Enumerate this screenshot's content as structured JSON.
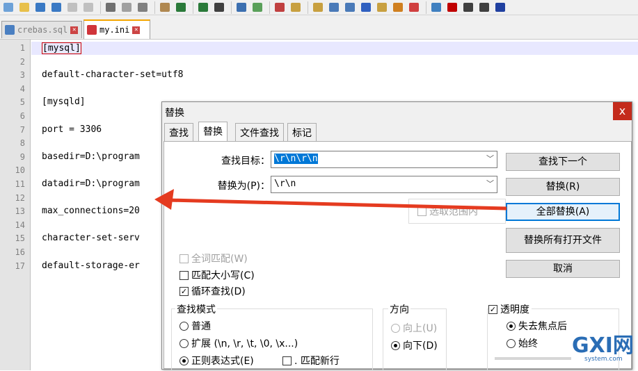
{
  "toolbar": {
    "icons": [
      "new-file-icon",
      "open-file-icon",
      "save-icon",
      "save-all-icon",
      "close-icon",
      "close-all-icon",
      "print-icon",
      "cut-icon",
      "copy-icon",
      "paste-icon",
      "undo-icon",
      "redo-icon",
      "find-icon",
      "replace-icon",
      "zoom-in-icon",
      "zoom-out-icon",
      "sync-vertical-icon",
      "sync-horizontal-icon",
      "word-wrap-icon",
      "show-all-chars-icon",
      "indent-guide-icon",
      "doc-map-icon",
      "function-list-icon",
      "folder-workspace-icon",
      "monitor-icon",
      "record-macro-icon",
      "stop-macro-icon",
      "play-macro-icon",
      "run-macro-icon"
    ]
  },
  "tabs": [
    {
      "label": "crebas.sql",
      "active": false
    },
    {
      "label": "my.ini",
      "active": true
    }
  ],
  "editor": {
    "lines": [
      {
        "n": "1",
        "text": "[mysql]"
      },
      {
        "n": "2",
        "text": ""
      },
      {
        "n": "3",
        "text": "default-character-set=utf8"
      },
      {
        "n": "4",
        "text": ""
      },
      {
        "n": "5",
        "text": "[mysqld]"
      },
      {
        "n": "6",
        "text": ""
      },
      {
        "n": "7",
        "text": "port = 3306"
      },
      {
        "n": "8",
        "text": ""
      },
      {
        "n": "9",
        "text": "basedir=D:\\program"
      },
      {
        "n": "10",
        "text": ""
      },
      {
        "n": "11",
        "text": "datadir=D:\\program"
      },
      {
        "n": "12",
        "text": ""
      },
      {
        "n": "13",
        "text": "max_connections=20"
      },
      {
        "n": "14",
        "text": ""
      },
      {
        "n": "15",
        "text": "character-set-serv"
      },
      {
        "n": "16",
        "text": ""
      },
      {
        "n": "17",
        "text": "default-storage-er"
      }
    ]
  },
  "dialog": {
    "title": "替换",
    "close": "x",
    "tabs": [
      "查找",
      "替换",
      "文件查找",
      "标记"
    ],
    "find_label": "查找目标：",
    "find_value": "\\r\\n\\r\\n",
    "replace_label": "替换为(P)：",
    "replace_value": "\\r\\n",
    "in_selection": "选取范围内",
    "buttons": {
      "find_next": "查找下一个",
      "replace": "替换(R)",
      "replace_all": "全部替换(A)",
      "replace_all_open": "替换所有打开文件",
      "cancel": "取消"
    },
    "options": {
      "whole_word": "全词匹配(W)",
      "match_case": "匹配大小写(C)",
      "wrap": "循环查找(D)"
    },
    "search_mode": {
      "title": "查找模式",
      "normal": "普通",
      "extended": "扩展 (\\n, \\r, \\t, \\0, \\x...)",
      "regex": "正则表达式(E)",
      "dot_newline": ". 匹配新行"
    },
    "direction": {
      "title": "方向",
      "up": "向上(U)",
      "down": "向下(D)"
    },
    "transparency": {
      "title": "透明度",
      "on_lose_focus": "失去焦点后",
      "always": "始终"
    }
  },
  "watermark": {
    "text": "GXI网",
    "sub": "system.com"
  }
}
